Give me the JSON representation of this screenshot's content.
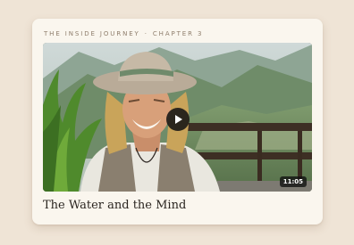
{
  "card": {
    "series": "THE INSIDE JOURNEY",
    "separator": "·",
    "chapter": "CHAPTER 3",
    "title": "The Water and the Mind"
  },
  "video": {
    "duration": "11:05",
    "play_icon": "play-icon",
    "thumbnail_alt": "Smiling man with long blond hair wearing a wide-brim hat, green mountains and a valley behind him"
  }
}
